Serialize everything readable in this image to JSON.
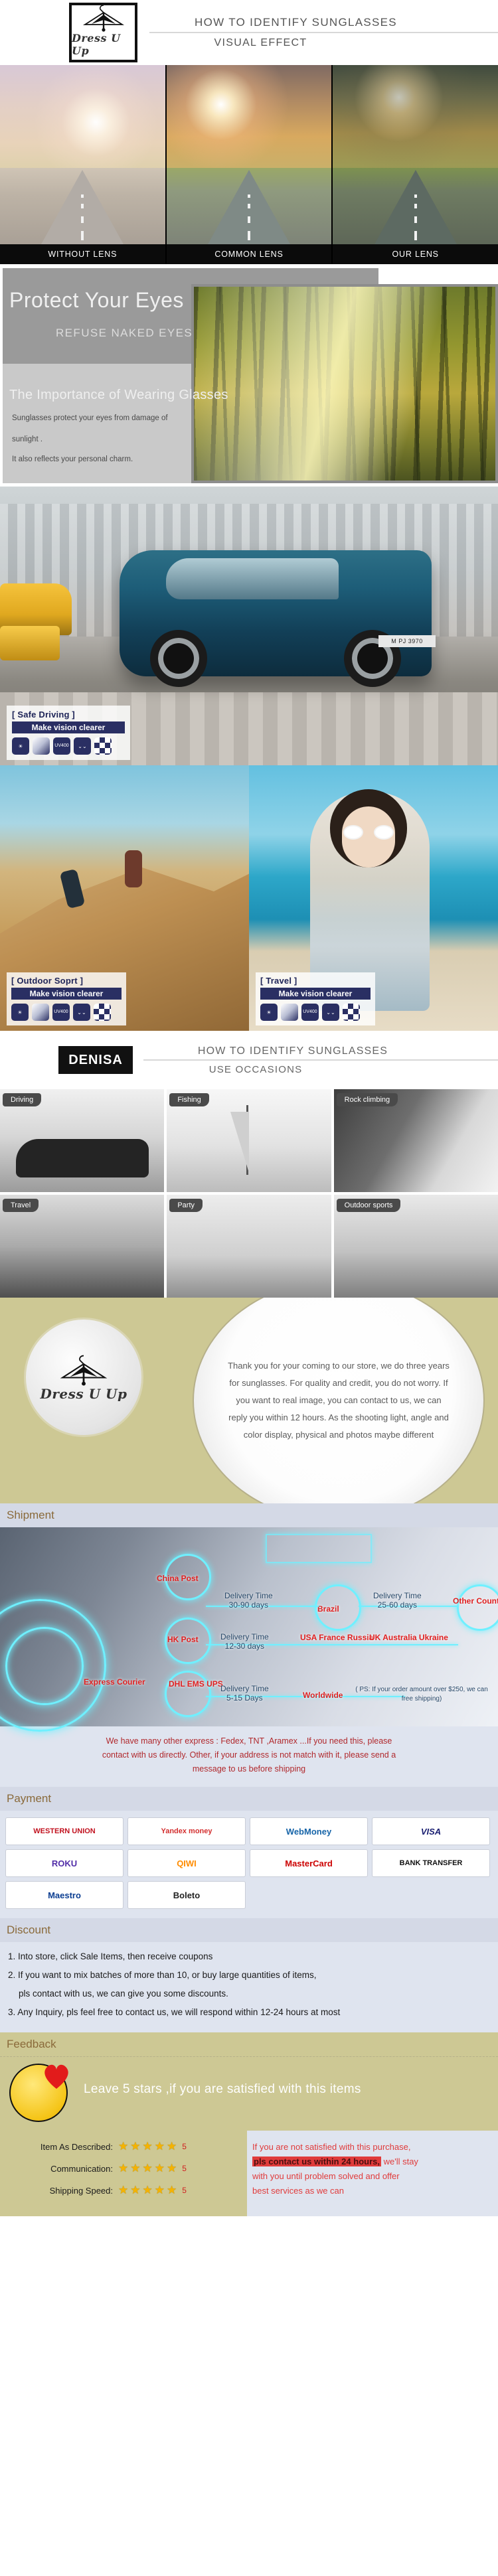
{
  "header": {
    "logo_word": "Dress U Up",
    "title_line1": "HOW TO IDENTIFY SUNGLASSES",
    "title_line2": "VISUAL EFFECT"
  },
  "lens_compare": {
    "labels": [
      "WITHOUT LENS",
      "COMMON LENS",
      "OUR LENS"
    ]
  },
  "protect": {
    "heading": "Protect Your Eyes",
    "subheading": "REFUSE NAKED EYES",
    "section_title": "The Importance of Wearing Glasses",
    "para1": "Sunglasses protect your eyes from damage of",
    "para2": "sunlight .",
    "para3": "It also reflects your personal charm."
  },
  "driving": {
    "badge_title": "[ Safe Driving ]",
    "badge_sub": "Make vision clearer",
    "plate": "M PJ 3970",
    "icons": [
      "sun-icon",
      "gradient-lens-icon",
      "uv400-icon",
      "eyelash-icon",
      "checker-icon"
    ]
  },
  "sport": {
    "badge_title": "[ Outdoor Soprt ]",
    "badge_sub": "Make vision clearer"
  },
  "travel": {
    "badge_title": "[ Travel ]",
    "badge_sub": "Make vision clearer"
  },
  "occasions": {
    "brand": "DENISA",
    "title_line1": "HOW TO IDENTIFY SUNGLASSES",
    "title_line2": "USE OCCASIONS",
    "tags_row1": [
      "Driving",
      "Fishing",
      "Rock climbing"
    ],
    "tags_row2": [
      "Travel",
      "Party",
      "Outdoor sports"
    ]
  },
  "thanks": {
    "logo_word": "Dress U Up",
    "text": "Thank you for your coming to our store, we do three years for sunglasses. For quality and credit, you do not worry. If you want to real image, you can contact to us, we can reply you within 12 hours. As the shooting light, angle and color display, physical and photos maybe different"
  },
  "shipment": {
    "heading": "Shipment",
    "nodes": [
      {
        "name": "China Post"
      },
      {
        "name": "Brazil"
      },
      {
        "name": "Other Countries"
      },
      {
        "name": "HK Post"
      },
      {
        "name": "USA France Russia"
      },
      {
        "name": "UK Australia Ukraine"
      },
      {
        "name": "DHL EMS UPS"
      },
      {
        "name": "Worldwide"
      },
      {
        "name": "Express Courier"
      }
    ],
    "delivery": [
      {
        "label": "Delivery Time",
        "value": "30-90 days"
      },
      {
        "label": "Delivery Time",
        "value": "25-60 days"
      },
      {
        "label": "Delivery Time",
        "value": "12-30 days"
      },
      {
        "label": "Delivery Time",
        "value": "5-15 Days"
      }
    ],
    "ps": "( PS: If your order amount over $250, we can free shipping)",
    "note_line1": "We have many other express : Fedex, TNT ,Aramex ...If you need this, please",
    "note_line2": "contact with us directly. Other, if your address is not match with it, please send a",
    "note_line3": "message to us before shipping"
  },
  "payment": {
    "heading": "Payment",
    "methods": [
      "WESTERN UNION",
      "Yandex money",
      "WebMoney",
      "VISA",
      "ROKU",
      "QIWI",
      "MasterCard",
      "BANK TRANSFER",
      "Maestro",
      "Boleto"
    ]
  },
  "discount": {
    "heading": "Discount",
    "items": [
      "1. Into store, click Sale Items, then receive coupons",
      "2. If you want to mix batches of more than 10, or buy large quantities of items,",
      "pls contact with us, we can give you some discounts.",
      "3. Any Inquiry, pls feel free to contact us, we will respond within 12-24 hours at most"
    ]
  },
  "feedback": {
    "heading": "Feedback",
    "banner": "Leave 5 stars ,if you are satisfied with this items",
    "ratings": [
      {
        "label": "Item As Described:",
        "stars": 5,
        "value": "5"
      },
      {
        "label": "Communication:",
        "stars": 5,
        "value": "5"
      },
      {
        "label": "Shipping Speed:",
        "stars": 5,
        "value": "5"
      }
    ],
    "notice_line1": "If you are not satisfied with this purchase,",
    "notice_highlight": "pls contact us within 24 hours,",
    "notice_tail": " we'll stay",
    "notice_line3": "with you until problem solved and offer",
    "notice_line4": "best services as we can"
  }
}
